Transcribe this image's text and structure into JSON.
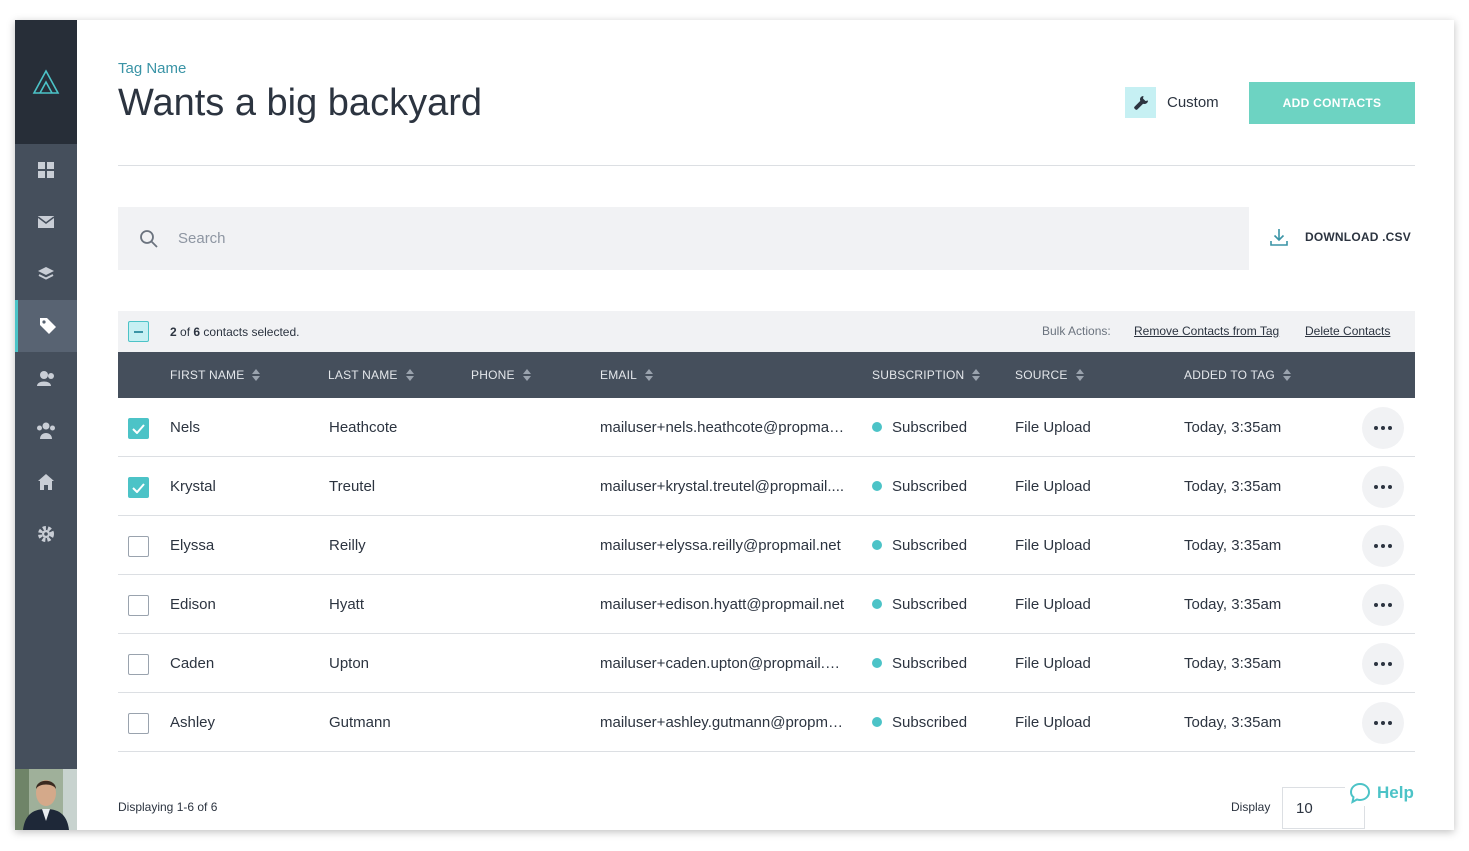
{
  "sidebar": {
    "items": [
      {
        "icon": "dashboard-icon"
      },
      {
        "icon": "mail-icon"
      },
      {
        "icon": "layers-icon"
      },
      {
        "icon": "tag-icon",
        "active": true
      },
      {
        "icon": "contacts-icon"
      },
      {
        "icon": "team-icon"
      },
      {
        "icon": "home-icon"
      },
      {
        "icon": "gear-icon"
      }
    ]
  },
  "header": {
    "tag_label": "Tag Name",
    "title": "Wants a big backyard",
    "custom_label": "Custom",
    "add_contacts_label": "ADD CONTACTS"
  },
  "search": {
    "placeholder": "Search",
    "value": ""
  },
  "download_label": "DOWNLOAD .CSV",
  "bulk": {
    "selected_count": "2",
    "of_text": "of",
    "total_count": "6",
    "suffix": "contacts selected.",
    "label": "Bulk Actions:",
    "remove_link": "Remove Contacts from Tag",
    "delete_link": "Delete Contacts"
  },
  "table": {
    "columns": [
      "FIRST NAME",
      "LAST NAME",
      "PHONE",
      "EMAIL",
      "SUBSCRIPTION",
      "SOURCE",
      "ADDED TO TAG"
    ],
    "rows": [
      {
        "checked": true,
        "first": "Nels",
        "last": "Heathcote",
        "phone": "",
        "email": "mailuser+nels.heathcote@propmail...",
        "subscription": "Subscribed",
        "source": "File Upload",
        "added": "Today, 3:35am"
      },
      {
        "checked": true,
        "first": "Krystal",
        "last": "Treutel",
        "phone": "",
        "email": "mailuser+krystal.treutel@propmail....",
        "subscription": "Subscribed",
        "source": "File Upload",
        "added": "Today, 3:35am"
      },
      {
        "checked": false,
        "first": "Elyssa",
        "last": "Reilly",
        "phone": "",
        "email": "mailuser+elyssa.reilly@propmail.net",
        "subscription": "Subscribed",
        "source": "File Upload",
        "added": "Today, 3:35am"
      },
      {
        "checked": false,
        "first": "Edison",
        "last": "Hyatt",
        "phone": "",
        "email": "mailuser+edison.hyatt@propmail.net",
        "subscription": "Subscribed",
        "source": "File Upload",
        "added": "Today, 3:35am"
      },
      {
        "checked": false,
        "first": "Caden",
        "last": "Upton",
        "phone": "",
        "email": "mailuser+caden.upton@propmail.net",
        "subscription": "Subscribed",
        "source": "File Upload",
        "added": "Today, 3:35am"
      },
      {
        "checked": false,
        "first": "Ashley",
        "last": "Gutmann",
        "phone": "",
        "email": "mailuser+ashley.gutmann@propma...",
        "subscription": "Subscribed",
        "source": "File Upload",
        "added": "Today, 3:35am"
      }
    ]
  },
  "footer": {
    "displaying": "Displaying 1-6 of 6",
    "display_label": "Display",
    "display_value": "10",
    "help_label": "Help"
  },
  "colors": {
    "accent": "#4cc3c7",
    "button": "#6dd3c2",
    "sidebar": "#454f5c",
    "sidebar_dark": "#272e38"
  }
}
